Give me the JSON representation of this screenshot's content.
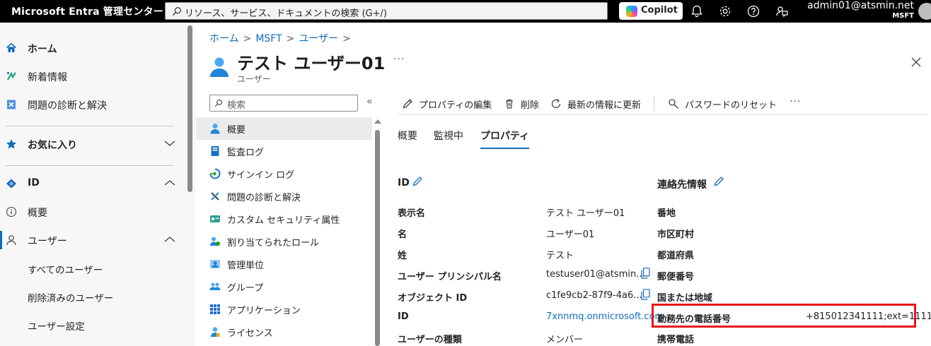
{
  "app": {
    "title": "Microsoft Entra 管理センター"
  },
  "search": {
    "placeholder": "リソース、サービス、ドキュメントの検索 (G+/)"
  },
  "copilot": {
    "label": "Copilot"
  },
  "topbar_icons": [
    "bell-icon",
    "gear-icon",
    "help-icon",
    "feedback-icon"
  ],
  "account": {
    "name": "admin01@atsmin.net",
    "tenant": "MSFT"
  },
  "sidebar": {
    "items": [
      {
        "label": "ホーム",
        "icon": "home-icon"
      },
      {
        "label": "新着情報",
        "icon": "whats-new-icon"
      },
      {
        "label": "問題の診断と解決",
        "icon": "diagnose-icon"
      },
      {
        "label": "お気に入り",
        "icon": "star-icon"
      },
      {
        "label": "ID",
        "icon": "identity-icon"
      },
      {
        "label": "概要",
        "icon": "info-icon"
      },
      {
        "label": "ユーザー",
        "icon": "user-icon"
      }
    ],
    "subitems": [
      {
        "label": "すべてのユーザー"
      },
      {
        "label": "削除済みのユーザー"
      },
      {
        "label": "ユーザー設定"
      }
    ]
  },
  "breadcrumb": [
    "ホーム",
    "MSFT",
    "ユーザー"
  ],
  "page": {
    "title": "テスト ユーザー01",
    "subtitle": "ユーザー",
    "more": "···"
  },
  "resource_menu": {
    "search_placeholder": "検索",
    "collapse": "«",
    "items": [
      {
        "label": "概要",
        "icon": "user-overview-icon",
        "selected": true
      },
      {
        "label": "監査ログ",
        "icon": "audit-log-icon"
      },
      {
        "label": "サインイン ログ",
        "icon": "sign-in-log-icon"
      },
      {
        "label": "問題の診断と解決",
        "icon": "tools-icon"
      },
      {
        "label": "カスタム セキュリティ属性",
        "icon": "custom-attribute-icon"
      },
      {
        "label": "割り当てられたロール",
        "icon": "assigned-roles-icon"
      },
      {
        "label": "管理単位",
        "icon": "admin-unit-icon"
      },
      {
        "label": "グループ",
        "icon": "group-icon"
      },
      {
        "label": "アプリケーション",
        "icon": "applications-icon"
      },
      {
        "label": "ライセンス",
        "icon": "license-icon"
      }
    ]
  },
  "toolbar": {
    "edit": "プロパティの編集",
    "delete": "削除",
    "refresh": "最新の情報に更新",
    "reset_password": "パスワードのリセット",
    "more": "···"
  },
  "tabs": [
    {
      "label": "概要"
    },
    {
      "label": "監視中"
    },
    {
      "label": "プロパティ",
      "active": true
    }
  ],
  "identity_section": {
    "title": "ID",
    "rows": [
      {
        "label": "表示名",
        "value": "テスト ユーザー01"
      },
      {
        "label": "名",
        "value": "ユーザー01"
      },
      {
        "label": "姓",
        "value": "テスト"
      },
      {
        "label": "ユーザー プリンシパル名",
        "value": "testuser01@atsmin....",
        "copy": true
      },
      {
        "label": "オブジェクト ID",
        "value": "c1fe9cb2-87f9-4a6...",
        "copy": true
      },
      {
        "label": "ID",
        "value": "7xnnmq.onmicrosoft.com",
        "link": true
      },
      {
        "label": "ユーザーの種類",
        "value": "メンバー"
      }
    ]
  },
  "contact_section": {
    "title": "連絡先情報",
    "rows": [
      {
        "label": "番地",
        "value": ""
      },
      {
        "label": "市区町村",
        "value": ""
      },
      {
        "label": "都道府県",
        "value": ""
      },
      {
        "label": "郵便番号",
        "value": ""
      },
      {
        "label": "国または地域",
        "value": ""
      },
      {
        "label": "勤務先の電話番号",
        "value": "+815012341111;ext=1111"
      },
      {
        "label": "携帯電話",
        "value": ""
      }
    ]
  },
  "colors": {
    "accent": "#0f6cbd",
    "highlight": "#e8141d",
    "topbar": "#000000"
  }
}
